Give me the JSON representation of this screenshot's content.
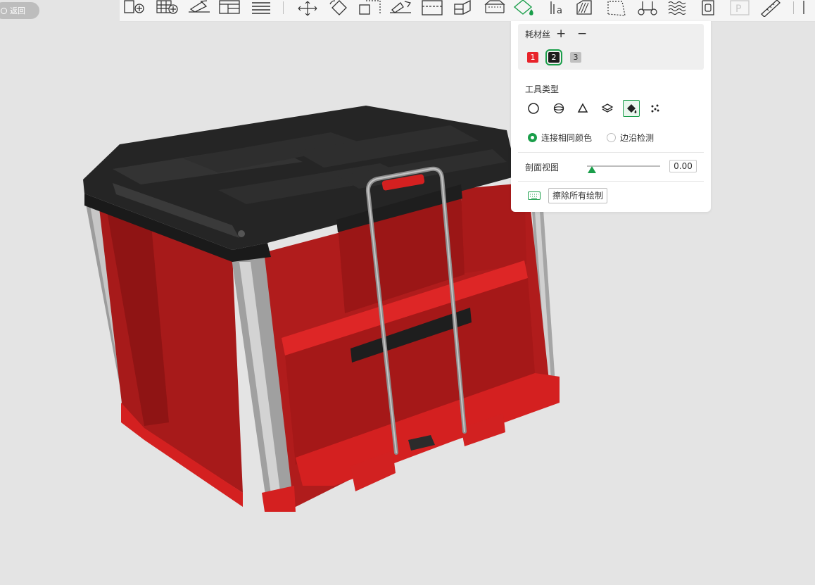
{
  "back_button": {
    "label": "返回"
  },
  "toolbar": {
    "buttons": [
      "add-part-icon",
      "arrange-grid-icon",
      "lay-flat-icon",
      "layout-icon",
      "layer-list-icon",
      "move-icon",
      "rotate-icon",
      "scale-icon",
      "mirror-icon",
      "cut-icon",
      "split-icon",
      "support-icon",
      "color-paint-icon",
      "text-icon",
      "seam-icon",
      "variable-height-icon",
      "brim-icon",
      "fuzzy-skin-icon",
      "assembly-icon",
      "plate-icon",
      "measure-icon",
      "more-icon"
    ]
  },
  "panel": {
    "filament_label": "耗材丝",
    "add_symbol": "+",
    "remove_symbol": "−",
    "filaments": [
      {
        "number": "1",
        "color": "#e8232a",
        "text_color": "#ffffff"
      },
      {
        "number": "2",
        "color": "#1c1c1c",
        "text_color": "#ffffff"
      },
      {
        "number": "3",
        "color": "#c0c0c0",
        "text_color": "#333333"
      }
    ],
    "selected_filament": "2",
    "tool_type_label": "工具类型",
    "tools": [
      "circle-brush-icon",
      "sphere-brush-icon",
      "triangle-brush-icon",
      "height-range-icon",
      "fill-bucket-icon",
      "gap-fill-icon"
    ],
    "active_tool": "fill-bucket-icon",
    "option_connect_color": "连接相同颜色",
    "option_edge_detect": "边沿检测",
    "selected_option": "connect_color",
    "section_view_label": "剖面视图",
    "section_view_value": "0.00",
    "clear_all_label": "擦除所有绘制",
    "accent_color": "#1a9e4a"
  }
}
